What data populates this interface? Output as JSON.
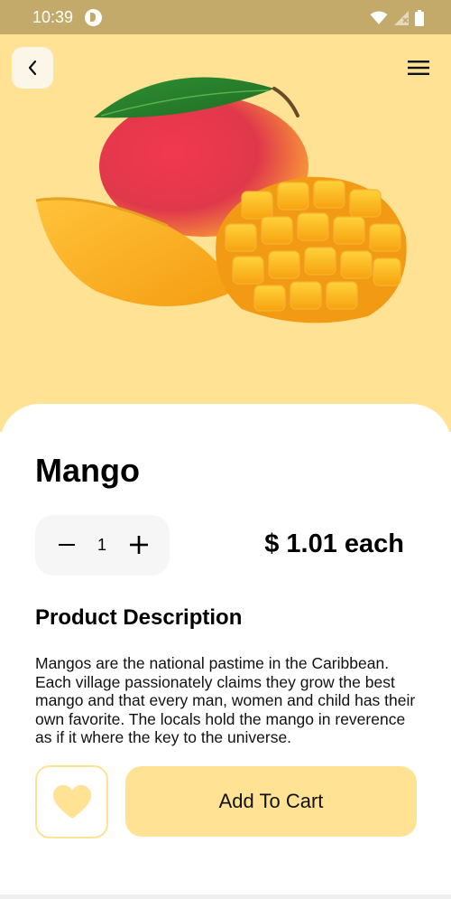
{
  "status_bar": {
    "time": "10:39",
    "icons": [
      "app-notification-icon",
      "wifi-icon",
      "signal-icon",
      "battery-icon"
    ]
  },
  "header": {
    "back_icon": "chevron-left-icon",
    "menu_icon": "hamburger-menu-icon"
  },
  "product": {
    "name": "Mango",
    "quantity": "1",
    "price_text": "$ 1.01 each",
    "image": "mango-fruit-illustration"
  },
  "description": {
    "heading": "Product Description",
    "body": "Mangos are the national pastime in the Caribbean. Each village passionately claims they grow the best mango and that every man, women and child has their own favorite. The locals hold the mango in reverence as if it where the key to the universe."
  },
  "actions": {
    "favorite_icon": "heart-icon",
    "add_to_cart_label": "Add To Cart"
  },
  "colors": {
    "hero_background": "#ffe293",
    "status_bar": "#c4aa6a",
    "accent": "#ffe293",
    "heart": "#ffe293"
  }
}
